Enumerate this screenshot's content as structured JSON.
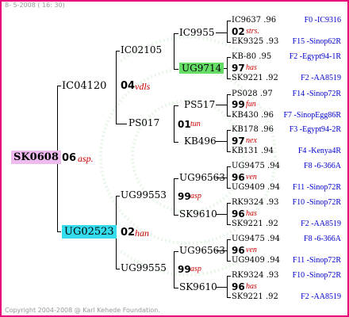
{
  "header": "8- 5-2008 ( 16: 30)",
  "footer": "Copyright 2004-2008 @ Karl Kehede Foundation.",
  "colors": {
    "frame": "#e8007a",
    "root_bg": "#eebbee",
    "sire2_bg": "#33ddee",
    "g3_bg": "#66dd66",
    "note": "#cc0000",
    "dam_line": "#0000cc"
  },
  "pedigree": {
    "root": {
      "id": "SK0608",
      "year": "06",
      "note": "asp."
    },
    "g1": [
      {
        "id": "IC04120",
        "year": "04",
        "note": "vdls"
      },
      {
        "id": "UG02523",
        "year": "02",
        "note": "han"
      }
    ],
    "g2": [
      {
        "id": "IC02105",
        "year": "",
        "note": ""
      },
      {
        "id": "PS017",
        "year": "01",
        "note": "tun"
      },
      {
        "id": "UG99553",
        "year": "99",
        "note": "asp"
      },
      {
        "id": "UG99555",
        "year": "99",
        "note": "asp"
      }
    ],
    "g3": [
      {
        "id": "IC9955",
        "year": "02",
        "note": "strs."
      },
      {
        "id": "UG9714",
        "year": "97",
        "note": "has"
      },
      {
        "id": "PS517",
        "year": "99",
        "note": "fun"
      },
      {
        "id": "KB496",
        "year": "97",
        "note": "nex"
      },
      {
        "id": "UG96563",
        "year": "96",
        "note": "ven"
      },
      {
        "id": "SK9610",
        "year": "96",
        "note": "has"
      },
      {
        "id": "UG96563",
        "year": "96",
        "note": "ven"
      },
      {
        "id": "SK9610",
        "year": "96",
        "note": "has"
      }
    ],
    "g4": [
      {
        "id": "IC9637",
        "yr": ".96",
        "line": "F0 -IC9316"
      },
      {
        "id": "EK9325",
        "yr": ".93",
        "line": "F15 -Sinop62R"
      },
      {
        "id": "KB-80",
        "yr": ".95",
        "line": "F2 -Egypt94-1R"
      },
      {
        "id": "SK9221",
        "yr": ".92",
        "line": "F2 -AA8519"
      },
      {
        "id": "PS028",
        "yr": ".97",
        "line": "F14 -Sinop72R"
      },
      {
        "id": "KB430",
        "yr": ".96",
        "line": "F7 -SinopEgg86R"
      },
      {
        "id": "KB178",
        "yr": ".96",
        "line": "F3 -Egypt94-2R"
      },
      {
        "id": "KB131",
        "yr": ".94",
        "line": "F4 -Kenya4R"
      },
      {
        "id": "UG9475",
        "yr": ".94",
        "line": "F8 -6-366A"
      },
      {
        "id": "UG9409",
        "yr": ".94",
        "line": "F11 -Sinop72R"
      },
      {
        "id": "RK9324",
        "yr": ".93",
        "line": "F10 -Sinop72R"
      },
      {
        "id": "SK9221",
        "yr": ".92",
        "line": "F2 -AA8519"
      },
      {
        "id": "UG9475",
        "yr": ".94",
        "line": "F8 -6-366A"
      },
      {
        "id": "UG9409",
        "yr": ".94",
        "line": "F11 -Sinop72R"
      },
      {
        "id": "RK9324",
        "yr": ".93",
        "line": "F10 -Sinop72R"
      },
      {
        "id": "SK9221",
        "yr": ".92",
        "line": "F2 -AA8519"
      }
    ]
  }
}
